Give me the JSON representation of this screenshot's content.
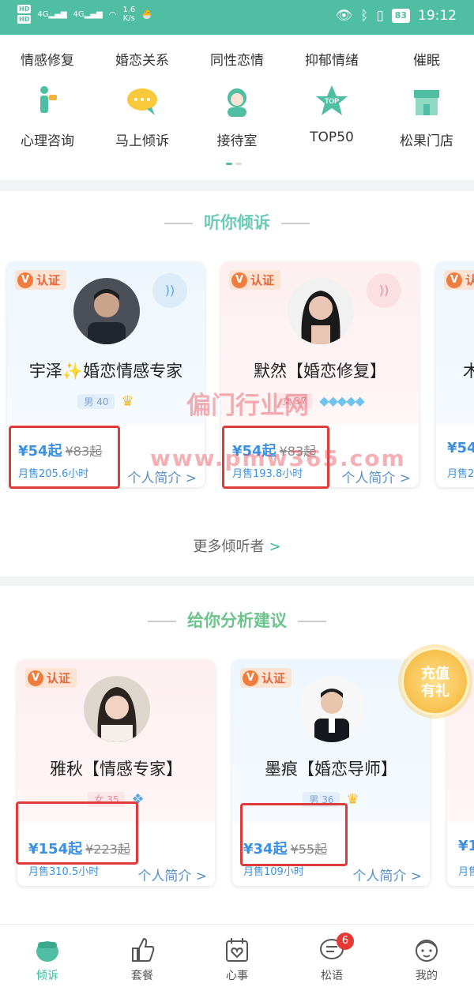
{
  "status": {
    "hd1": "HD",
    "hd2": "HD",
    "net1": "4G",
    "net2": "4G",
    "speed": "1.6",
    "speed_unit": "K/s",
    "battery": "83",
    "time": "19:12"
  },
  "categories": [
    "情感修复",
    "婚恋关系",
    "同性恋情",
    "抑郁情绪",
    "催眠"
  ],
  "quick_links": [
    {
      "label": "心理咨询",
      "icon": "person-consult-icon"
    },
    {
      "label": "马上倾诉",
      "icon": "chat-bubble-icon"
    },
    {
      "label": "接待室",
      "icon": "headset-agent-icon"
    },
    {
      "label": "TOP50",
      "icon": "star-top-icon"
    },
    {
      "label": "松果门店",
      "icon": "store-icon"
    }
  ],
  "section1": {
    "title": "听你倾诉",
    "more": "更多倾听者",
    "cards": [
      {
        "cert": "认证",
        "name": "宇泽✨婚恋情感专家",
        "gender_age": "男 40",
        "price": "¥54起",
        "old_price": "¥83起",
        "sales": "月售205.6小时",
        "intro": "个人简介 >"
      },
      {
        "cert": "认证",
        "name": "默然【婚恋修复】",
        "gender_age": "女 37",
        "price": "¥54起",
        "old_price": "¥83起",
        "sales": "月售193.8小时",
        "intro": "个人简介 >"
      },
      {
        "cert": "认",
        "name": "木",
        "price": "¥54",
        "sales": "月售2"
      }
    ]
  },
  "section2": {
    "title": "给你分析建议",
    "promo": "充值有礼",
    "cards": [
      {
        "cert": "认证",
        "name": "雅秋【情感专家】",
        "gender_age": "女 35",
        "price": "¥154起",
        "old_price": "¥223起",
        "sales": "月售310.5小时",
        "intro": "个人简介 >"
      },
      {
        "cert": "认证",
        "name": "墨痕【婚恋导师】",
        "gender_age": "男 36",
        "price": "¥34起",
        "old_price": "¥55起",
        "sales": "月售109小时",
        "intro": "个人简介 >"
      },
      {
        "price": "¥1",
        "sales": "月售"
      }
    ]
  },
  "watermark": {
    "line1": "偏门行业网",
    "line2": "www.pmw365.com"
  },
  "bottom_nav": [
    {
      "label": "倾诉",
      "active": true
    },
    {
      "label": "套餐"
    },
    {
      "label": "心事"
    },
    {
      "label": "松语",
      "badge": "6"
    },
    {
      "label": "我的"
    }
  ],
  "colors": {
    "brand": "#4fbea2",
    "price": "#3b91e0",
    "highlight_box": "#e03b3b"
  }
}
